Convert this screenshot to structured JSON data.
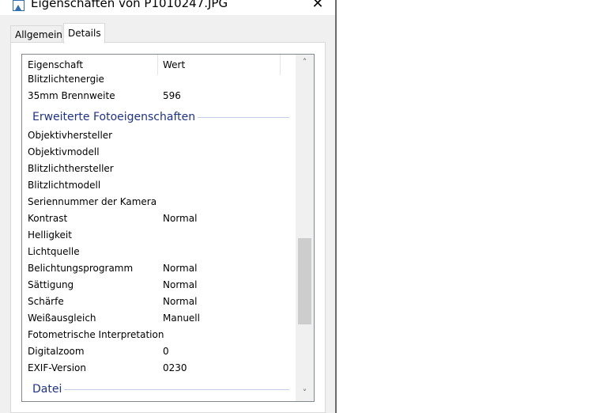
{
  "window": {
    "title": "Eigenschaften von P1010247.JPG",
    "close_icon": "close-icon"
  },
  "tabs": [
    {
      "label": "Allgemein",
      "active": false
    },
    {
      "label": "Details",
      "active": true
    }
  ],
  "list": {
    "columns": {
      "name": "Eigenschaft",
      "value": "Wert"
    },
    "rows_top": [
      {
        "name": "Blitzlichtenergie",
        "value": ""
      },
      {
        "name": "35mm Brennweite",
        "value": "596"
      }
    ],
    "group1": "Erweiterte Fotoeigenschaften",
    "rows": [
      {
        "name": "Objektivhersteller",
        "value": ""
      },
      {
        "name": "Objektivmodell",
        "value": ""
      },
      {
        "name": "Blitzlichthersteller",
        "value": ""
      },
      {
        "name": "Blitzlichtmodell",
        "value": ""
      },
      {
        "name": "Seriennummer der Kamera",
        "value": ""
      },
      {
        "name": "Kontrast",
        "value": "Normal"
      },
      {
        "name": "Helligkeit",
        "value": ""
      },
      {
        "name": "Lichtquelle",
        "value": ""
      },
      {
        "name": "Belichtungsprogramm",
        "value": "Normal"
      },
      {
        "name": "Sättigung",
        "value": "Normal"
      },
      {
        "name": "Schärfe",
        "value": "Normal"
      },
      {
        "name": "Weißausgleich",
        "value": "Manuell"
      },
      {
        "name": "Fotometrische Interpretation",
        "value": ""
      },
      {
        "name": "Digitalzoom",
        "value": "0"
      },
      {
        "name": "EXIF-Version",
        "value": "0230"
      }
    ],
    "group2": "Datei"
  },
  "colors": {
    "group_title": "#1e3287",
    "window_bg": "#f0f0f0",
    "accent_icon": "#2b6fb6"
  }
}
